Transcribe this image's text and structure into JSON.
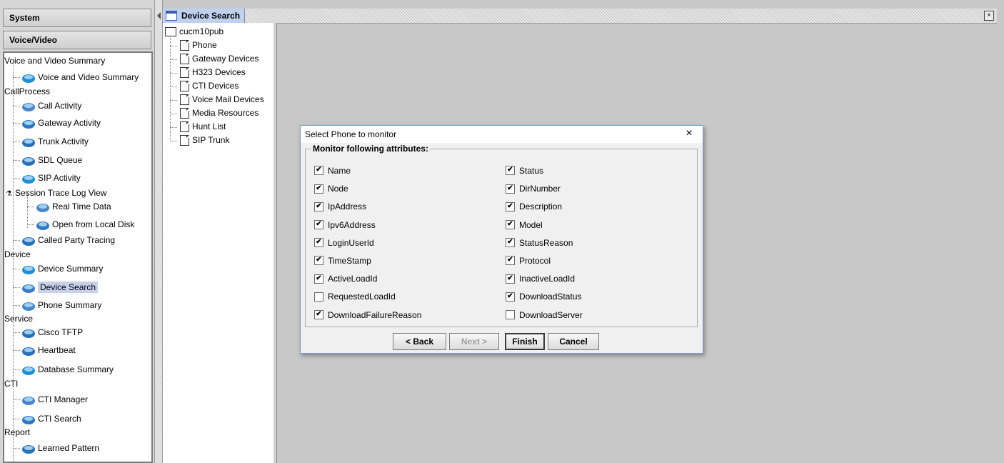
{
  "nav": {
    "categories": [
      "System",
      "Voice/Video"
    ],
    "tree": [
      {
        "label": "Voice and Video Summary",
        "type": "section"
      },
      {
        "label": "Voice and Video Summary",
        "type": "item"
      },
      {
        "label": "CallProcess",
        "type": "section"
      },
      {
        "label": "Call Activity",
        "type": "item"
      },
      {
        "label": "Gateway Activity",
        "type": "item"
      },
      {
        "label": "Trunk Activity",
        "type": "item"
      },
      {
        "label": "SDL Queue",
        "type": "item"
      },
      {
        "label": "SIP Activity",
        "type": "item"
      },
      {
        "label": "Session Trace Log View",
        "type": "subsection"
      },
      {
        "label": "Real Time Data",
        "type": "subitem"
      },
      {
        "label": "Open from Local Disk",
        "type": "subitem"
      },
      {
        "label": "Called Party Tracing",
        "type": "item"
      },
      {
        "label": "Device",
        "type": "section"
      },
      {
        "label": "Device Summary",
        "type": "item"
      },
      {
        "label": "Device Search",
        "type": "item",
        "selected": true
      },
      {
        "label": "Phone Summary",
        "type": "item"
      },
      {
        "label": "Service",
        "type": "section"
      },
      {
        "label": "Cisco TFTP",
        "type": "item"
      },
      {
        "label": "Heartbeat",
        "type": "item"
      },
      {
        "label": "Database Summary",
        "type": "item"
      },
      {
        "label": "CTI",
        "type": "section"
      },
      {
        "label": "CTI Manager",
        "type": "item"
      },
      {
        "label": "CTI Search",
        "type": "item"
      },
      {
        "label": "Report",
        "type": "section"
      },
      {
        "label": "Learned Pattern",
        "type": "item"
      }
    ]
  },
  "window": {
    "title": "Device Search"
  },
  "device_tree": {
    "root": "cucm10pub",
    "children": [
      "Phone",
      "Gateway Devices",
      "H323 Devices",
      "CTI Devices",
      "Voice Mail Devices",
      "Media Resources",
      "Hunt List",
      "SIP Trunk"
    ]
  },
  "dialog": {
    "title": "Select Phone to monitor",
    "close": "×",
    "group_label": "Monitor following attributes:",
    "left_attrs": [
      {
        "label": "Name",
        "checked": true
      },
      {
        "label": "Node",
        "checked": true
      },
      {
        "label": "IpAddress",
        "checked": true
      },
      {
        "label": "Ipv6Address",
        "checked": true
      },
      {
        "label": "LoginUserId",
        "checked": true
      },
      {
        "label": "TimeStamp",
        "checked": true
      },
      {
        "label": "ActiveLoadId",
        "checked": true
      },
      {
        "label": "RequestedLoadId",
        "checked": false
      },
      {
        "label": "DownloadFailureReason",
        "checked": true
      }
    ],
    "right_attrs": [
      {
        "label": "Status",
        "checked": true
      },
      {
        "label": "DirNumber",
        "checked": true
      },
      {
        "label": "Description",
        "checked": true
      },
      {
        "label": "Model",
        "checked": true
      },
      {
        "label": "StatusReason",
        "checked": true
      },
      {
        "label": "Protocol",
        "checked": true
      },
      {
        "label": "InactiveLoadId",
        "checked": true
      },
      {
        "label": "DownloadStatus",
        "checked": true
      },
      {
        "label": "DownloadServer",
        "checked": false
      }
    ],
    "buttons": {
      "back": "< Back",
      "next": "Next >",
      "finish": "Finish",
      "cancel": "Cancel"
    }
  }
}
